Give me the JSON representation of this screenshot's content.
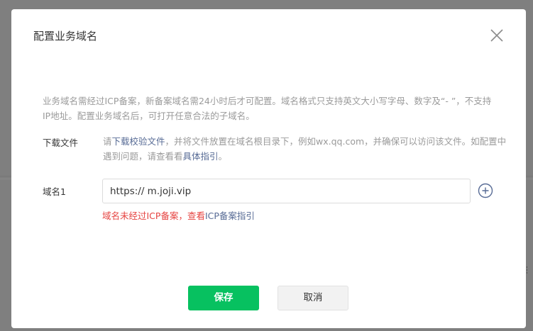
{
  "dialog": {
    "title": "配置业务域名",
    "intro": "业务域名需经过ICP备案，新备案域名需24小时后才可配置。域名格式只支持英文大小写字母、数字及“- ”，不支持IP地址。配置业务域名后，可打开任意合法的子域名。"
  },
  "download": {
    "label": "下载文件",
    "prefix": "请",
    "file_link": "下载校验文件",
    "middle": "，并将文件放置在域名根目录下，例如wx.qq.com，并确保可以访问该文件。如配置中遇到问题，请查看看",
    "guide_link": "具体指引",
    "suffix": "。"
  },
  "domain1": {
    "label": "域名1",
    "value": "https:// m.joji.vip",
    "error_text": "域名未经过ICP备案，查看",
    "error_link": "ICP备案指引"
  },
  "buttons": {
    "save": "保存",
    "cancel": "取消"
  },
  "icons": {
    "close": "close-icon",
    "add": "plus-circle-icon"
  },
  "colors": {
    "primary": "#07c160",
    "error": "#e64340",
    "link": "#576b95",
    "muted": "#9a9a9a"
  }
}
